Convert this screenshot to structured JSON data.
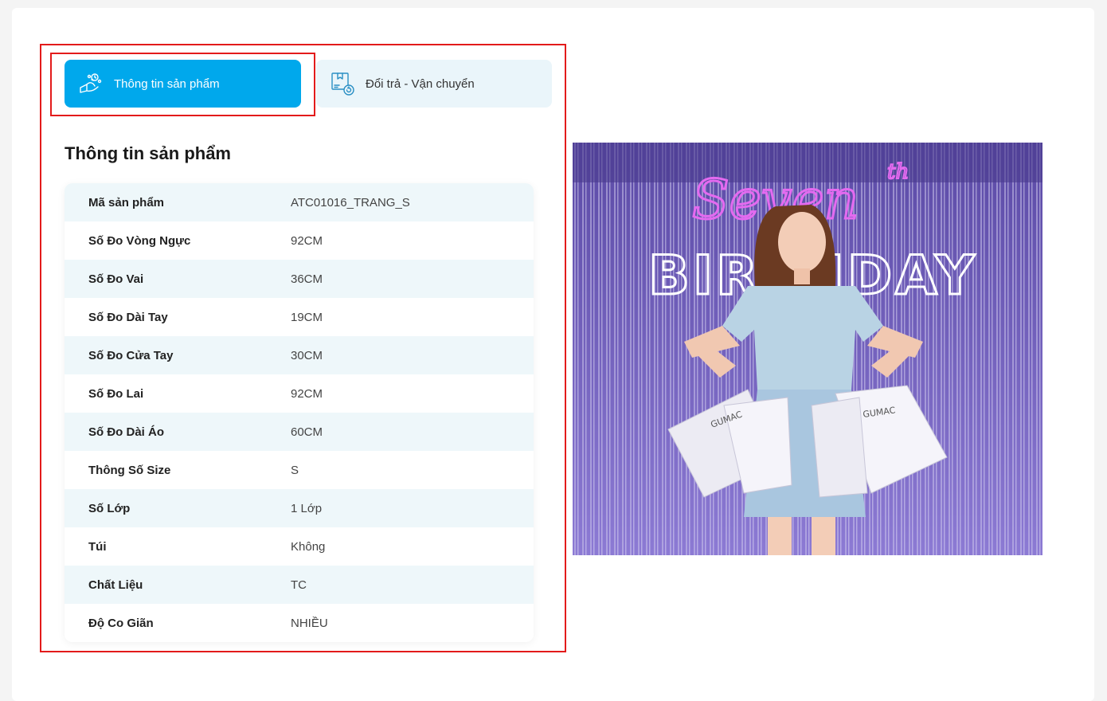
{
  "tabs": [
    {
      "label": "Thông tin sản phẩm",
      "icon": "product-info-icon",
      "active": true
    },
    {
      "label": "Đổi trả - Vận chuyển",
      "icon": "shipping-return-icon",
      "active": false
    }
  ],
  "section": {
    "title": "Thông tin sản phẩm"
  },
  "specs": [
    {
      "label": "Mã sản phẩm",
      "value": "ATC01016_TRANG_S"
    },
    {
      "label": "Số Đo Vòng Ngực",
      "value": "92CM"
    },
    {
      "label": "Số Đo Vai",
      "value": "36CM"
    },
    {
      "label": "Số Đo Dài Tay",
      "value": "19CM"
    },
    {
      "label": "Số Đo Cửa Tay",
      "value": "30CM"
    },
    {
      "label": "Số Đo Lai",
      "value": "92CM"
    },
    {
      "label": "Số Đo Dài Áo",
      "value": "60CM"
    },
    {
      "label": "Thông Số Size",
      "value": "S"
    },
    {
      "label": "Số Lớp",
      "value": "1 Lớp"
    },
    {
      "label": "Túi",
      "value": "Không"
    },
    {
      "label": "Chất Liệu",
      "value": "TC"
    },
    {
      "label": "Độ Co Giãn",
      "value": "NHIỀU"
    }
  ],
  "promo": {
    "neon_script": "Seven",
    "neon_sup": "th",
    "neon_block": "BIRTHDAY",
    "bag_brand": "GUMAC"
  },
  "colors": {
    "accent": "#00a8ec",
    "tab_inactive_bg": "#eaf5fa",
    "row_alt_bg": "#eef7fa",
    "highlight_outline": "#e31b1b"
  }
}
